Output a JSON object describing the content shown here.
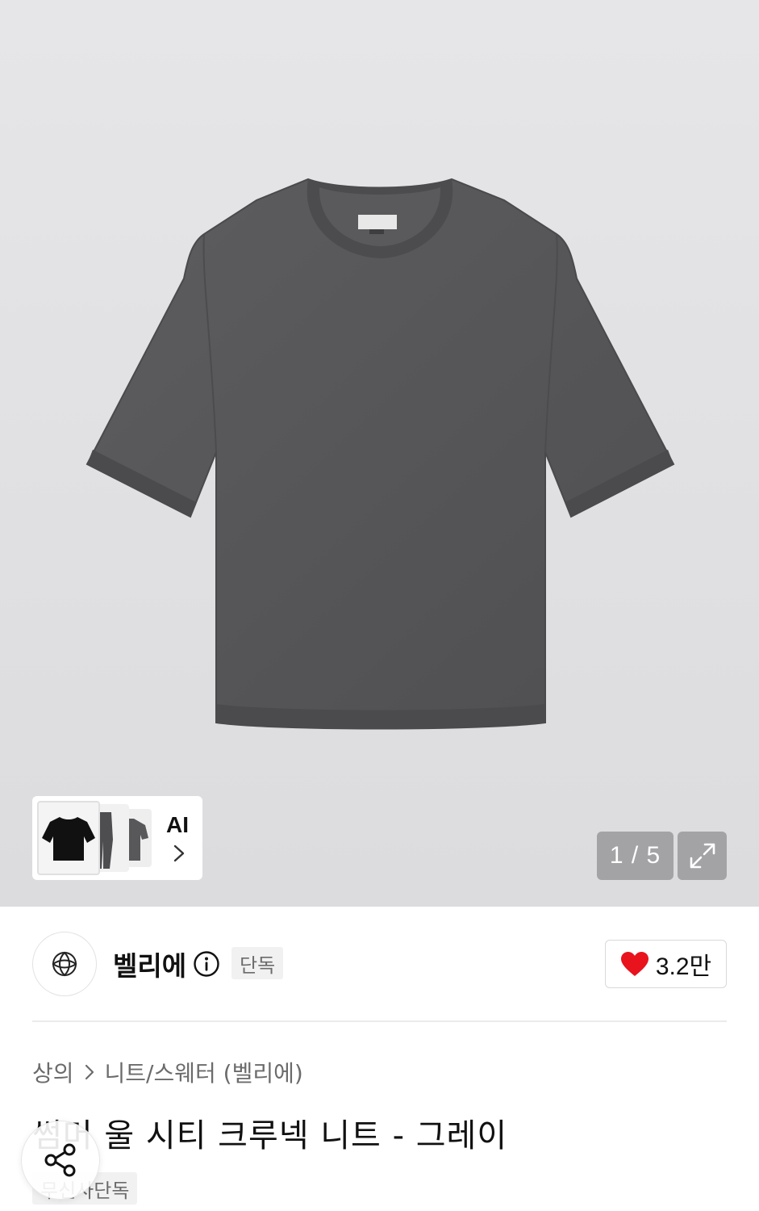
{
  "gallery": {
    "ai_label": "AI",
    "page_counter": "1 / 5",
    "icons": [
      "chevron-right-icon",
      "expand-icon"
    ]
  },
  "brand": {
    "name": "벨리에",
    "badge": "단독",
    "icons": [
      "brand-logo-icon",
      "info-icon"
    ]
  },
  "like": {
    "count": "3.2만",
    "heart_color": "#e8131d"
  },
  "breadcrumb": {
    "category": "상의",
    "subcategory": "니트/스웨터 (벨리에)"
  },
  "product": {
    "title": "썸머 울 시티 크루넥 니트 - 그레이",
    "badge": "무신사단독"
  },
  "share": {
    "icon": "share-icon"
  },
  "colors": {
    "hero_bg": "#e4e4e6",
    "shirt": "#58585a",
    "text_primary": "#111111",
    "text_secondary": "#6b6b6b"
  }
}
